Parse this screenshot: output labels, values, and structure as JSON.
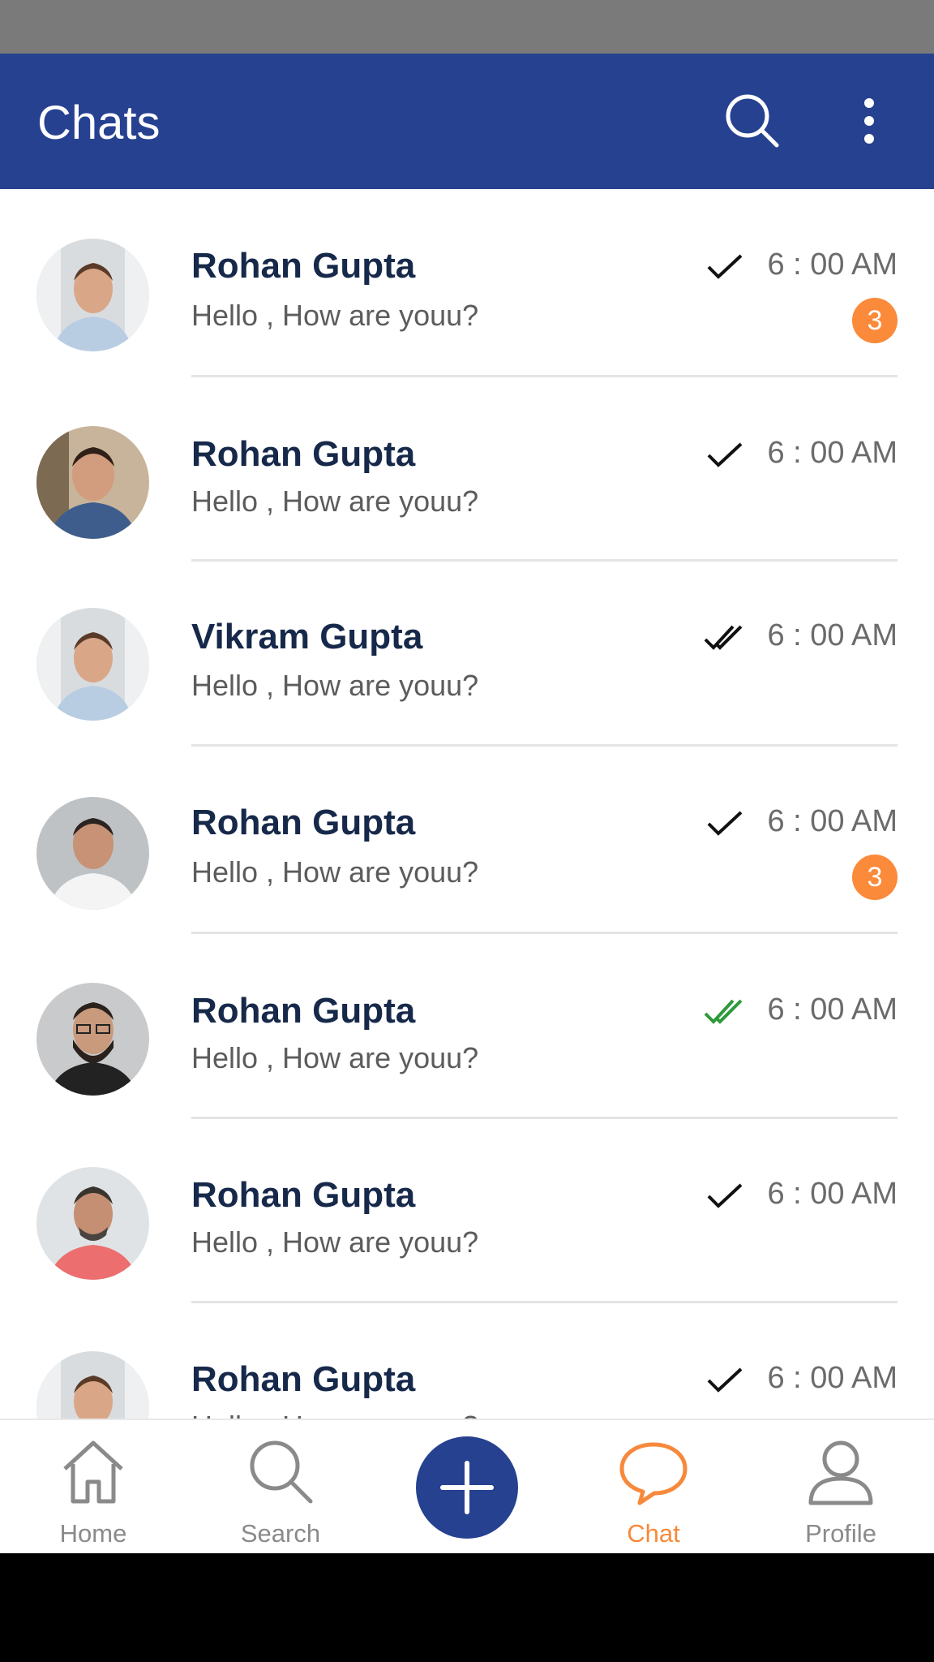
{
  "appbar": {
    "title": "Chats"
  },
  "chats": [
    {
      "name": "Rohan Gupta",
      "message": "Hello , How are youu?",
      "time": "6 : 00 AM",
      "tick": "single",
      "badge": "3"
    },
    {
      "name": "Rohan Gupta",
      "message": "Hello , How are youu?",
      "time": "6 : 00 AM",
      "tick": "single",
      "badge": ""
    },
    {
      "name": "Vikram Gupta",
      "message": "Hello , How are youu?",
      "time": "6 : 00 AM",
      "tick": "double",
      "badge": ""
    },
    {
      "name": "Rohan Gupta",
      "message": "Hello , How are youu?",
      "time": "6 : 00 AM",
      "tick": "single",
      "badge": "3"
    },
    {
      "name": "Rohan Gupta",
      "message": "Hello , How are youu?",
      "time": "6 : 00 AM",
      "tick": "double-read",
      "badge": ""
    },
    {
      "name": "Rohan Gupta",
      "message": "Hello , How are youu?",
      "time": "6 : 00 AM",
      "tick": "single",
      "badge": ""
    },
    {
      "name": "Rohan Gupta",
      "message": "Hello , How are youu?",
      "time": "6 : 00 AM",
      "tick": "single",
      "badge": ""
    }
  ],
  "bottom_nav": {
    "home": "Home",
    "search": "Search",
    "chat": "Chat",
    "profile": "Profile",
    "active": "chat"
  },
  "colors": {
    "primary": "#264190",
    "accent": "#fb8a3a",
    "read_tick": "#2e9a3a"
  }
}
